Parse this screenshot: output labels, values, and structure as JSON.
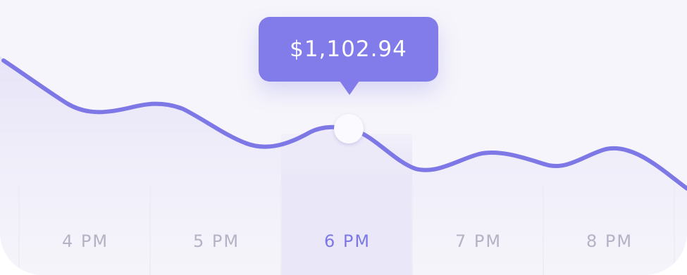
{
  "chart_data": {
    "type": "area",
    "categories": [
      "4 PM",
      "5 PM",
      "6 PM",
      "7 PM",
      "8 PM"
    ],
    "active_category": "6 PM",
    "tooltip_label": "$1,102.94",
    "colors": {
      "line": "#7d78e6",
      "area": "#e6e3f7",
      "highlight_column": "#e4e1f7",
      "tooltip": "#817ce9",
      "active_tick": "#7d78e6",
      "inactive_tick": "#b4b2c4",
      "background": "#f6f5fb"
    }
  }
}
